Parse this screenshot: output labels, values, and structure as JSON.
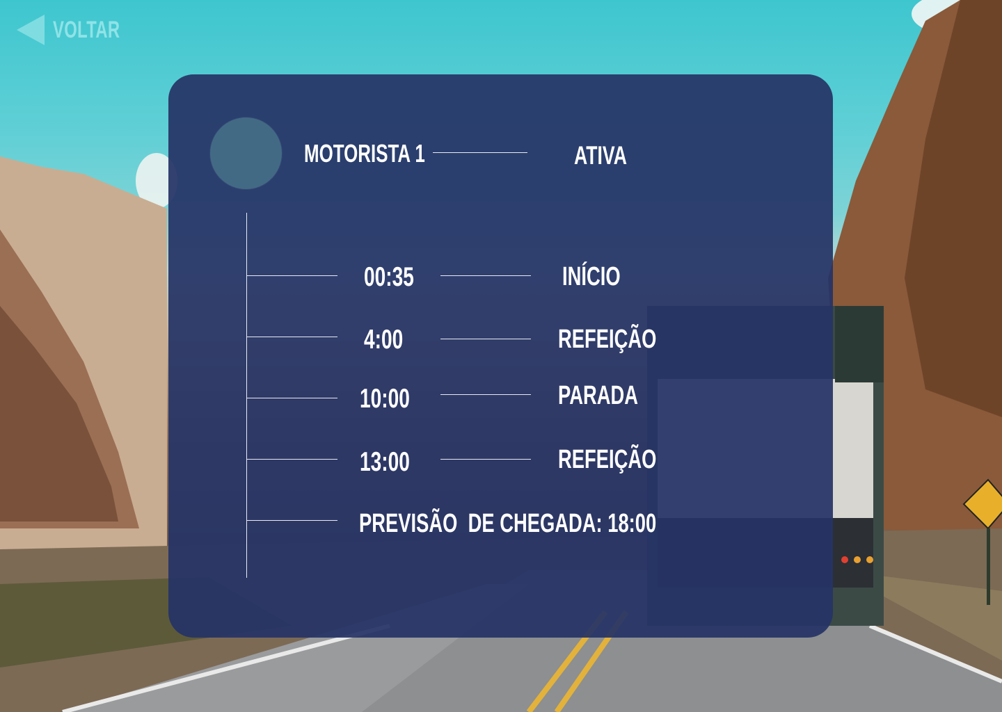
{
  "nav": {
    "back_label": "VOLTAR",
    "back_icon": "back-arrow-icon"
  },
  "driver": {
    "name": "MOTORISTA 1",
    "status": "ATIVA"
  },
  "timeline": [
    {
      "time": "00:35",
      "label": "INÍCIO"
    },
    {
      "time": "4:00",
      "label": "REFEIÇÃO"
    },
    {
      "time": "10:00",
      "label": "PARADA"
    },
    {
      "time": "13:00",
      "label": "REFEIÇÃO"
    }
  ],
  "eta": "PREVISÃO  DE CHEGADA: 18:00",
  "colors": {
    "card_background": "#263466",
    "text": "#ffffff",
    "accent": "#7fdde2",
    "avatar": "#436a85",
    "lines": "#e9ecf5"
  }
}
